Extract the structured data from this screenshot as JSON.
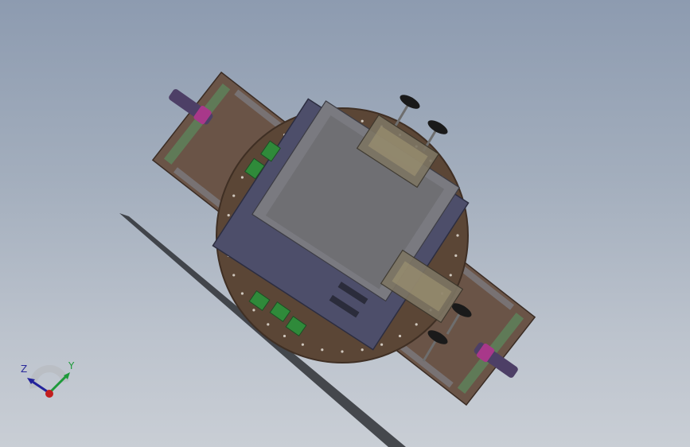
{
  "viewport": {
    "background_top": "#8d9bb0",
    "background_bottom": "#c9ced5"
  },
  "model": {
    "colors": {
      "turntable": "#5b4636",
      "turntable_edge": "#3f2f24",
      "base_plate": "#6a5447",
      "rail": "#5f7a57",
      "frame_gray": "#7f7f86",
      "box_side": "#4d4e6a",
      "box_top": "#7a7a80",
      "box_floor": "#6f6f73",
      "green_part": "#2f8a3a",
      "knob": "#1a1a1a",
      "shaft": "#4d3f66",
      "collar": "#a8388a"
    }
  },
  "triad": {
    "z_label": "Z",
    "y_label": "Y",
    "icons": [
      "z-axis-arrow-icon",
      "y-axis-arrow-icon",
      "origin-dot-icon"
    ]
  }
}
